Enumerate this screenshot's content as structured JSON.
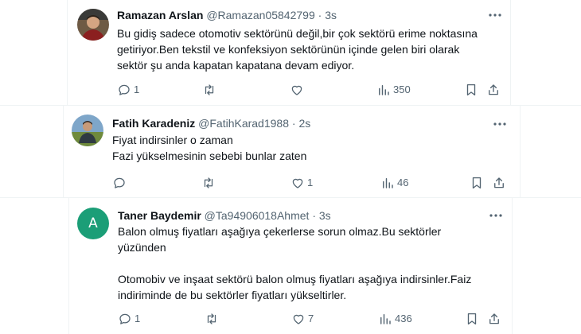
{
  "tweets": [
    {
      "name": "Ramazan Arslan",
      "handle": "@Ramazan05842799",
      "separator": "·",
      "time": "3s",
      "lines": [
        "Bu gidiş sadece otomotiv sektörünü değil,bir çok sektörü erime noktasına",
        "getiriyor.Ben tekstil ve konfeksiyon sektörünün içinde gelen biri olarak",
        "sektör şu anda kapatan kapatana devam ediyor."
      ],
      "replies": "1",
      "retweets": "",
      "likes": "",
      "views": "350"
    },
    {
      "name": "Fatih Karadeniz",
      "handle": "@FatihKarad1988",
      "separator": "·",
      "time": "2s",
      "lines": [
        "Fiyat indirsinler o zaman",
        "Fazi yükselmesinin sebebi bunlar zaten"
      ],
      "replies": "",
      "retweets": "",
      "likes": "1",
      "views": "46"
    },
    {
      "name": "Taner Baydemir",
      "handle": "@Ta94906018Ahmet",
      "separator": "·",
      "time": "3s",
      "avatar_letter": "A",
      "lines": [
        "Balon olmuş fiyatları aşağıya çekerlerse sorun olmaz.Bu sektörler",
        "yüzünden"
      ],
      "lines2": [
        "Otomobiv ve inşaat sektörü balon olmuş fiyatları aşağıya indirsinler.Faiz",
        "indiriminde de bu sektörler fiyatları yükseltirler."
      ],
      "replies": "1",
      "retweets": "",
      "likes": "7",
      "views": "436"
    }
  ],
  "icons": [
    "more-icon",
    "reply-icon",
    "retweet-icon",
    "like-icon",
    "views-icon",
    "bookmark-icon",
    "share-icon"
  ],
  "colors": {
    "text": "#0f1419",
    "muted": "#536471",
    "divider": "#eff3f4",
    "avatar_letter_bg": "#1b9e77"
  }
}
